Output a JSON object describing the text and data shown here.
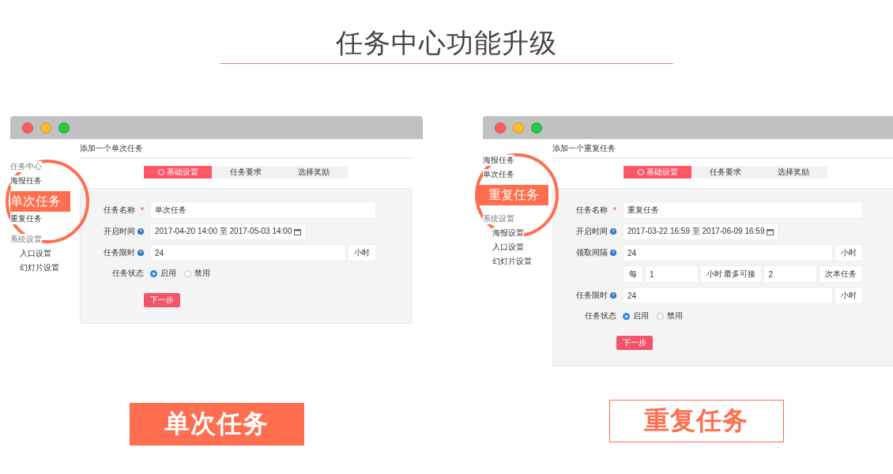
{
  "title": "任务中心功能升级",
  "panels": [
    {
      "window": {
        "sidebar": [
          {
            "kind": "group",
            "label": "任务中心"
          },
          {
            "kind": "item",
            "label": "海报任务"
          },
          {
            "kind": "callout",
            "label": "单次任务"
          },
          {
            "kind": "item",
            "label": "重复任务"
          },
          {
            "kind": "group",
            "label": "系统设置"
          },
          {
            "kind": "subitem",
            "label": "入口设置"
          },
          {
            "kind": "subitem",
            "label": "幻灯片设置"
          }
        ],
        "header": "添加一个单次任务",
        "tabs": [
          {
            "label": "基础设置",
            "selected": true
          },
          {
            "label": "任务要求",
            "selected": false
          },
          {
            "label": "选择奖励",
            "selected": false
          }
        ],
        "form": [
          {
            "kind": "text",
            "label": "任务名称",
            "required_mark": "*",
            "value": "单次任务"
          },
          {
            "kind": "date",
            "label": "开启时间",
            "help": true,
            "value": "2017-04-20 14:00 至 2017-05-03 14:00"
          },
          {
            "kind": "suffix",
            "label": "任务限时",
            "help": true,
            "value": "24",
            "suffix": "小时"
          },
          {
            "kind": "radio",
            "label": "任务状态",
            "options": [
              {
                "label": "启用",
                "selected": true
              },
              {
                "label": "禁用",
                "selected": false
              }
            ]
          }
        ],
        "submit": "下一步"
      },
      "caption": {
        "text": "单次任务",
        "kind": "filled"
      }
    },
    {
      "window": {
        "sidebar": [
          {
            "kind": "item",
            "label": "海报任务"
          },
          {
            "kind": "item",
            "label": "单次任务"
          },
          {
            "kind": "callout",
            "label": "重复任务"
          },
          {
            "kind": "group",
            "label": "系统设置"
          },
          {
            "kind": "subitem",
            "label": "海报设置"
          },
          {
            "kind": "subitem",
            "label": "入口设置"
          },
          {
            "kind": "subitem",
            "label": "幻灯片设置"
          }
        ],
        "header": "添加一个重复任务",
        "tabs": [
          {
            "label": "基础设置",
            "selected": true
          },
          {
            "label": "任务要求",
            "selected": false
          },
          {
            "label": "选择奖励",
            "selected": false
          }
        ],
        "form": [
          {
            "kind": "text",
            "label": "任务名称",
            "required_mark": "*",
            "value": "重复任务"
          },
          {
            "kind": "date",
            "label": "开启时间",
            "help": true,
            "value": "2017-03-22 16:59 至 2017-06-09 16:59"
          },
          {
            "kind": "suffix",
            "label": "领取间隔",
            "help": true,
            "value": "24",
            "suffix": "小时"
          },
          {
            "kind": "interval",
            "parts": [
              {
                "kind": "addon",
                "text": "每"
              },
              {
                "kind": "input",
                "text": "1"
              },
              {
                "kind": "addon",
                "text": "小时 最多可接"
              },
              {
                "kind": "input",
                "text": "2"
              },
              {
                "kind": "addon",
                "text": "次本任务"
              }
            ]
          },
          {
            "kind": "suffix",
            "label": "任务限时",
            "help": true,
            "value": "24",
            "suffix": "小时"
          },
          {
            "kind": "radio",
            "label": "任务状态",
            "options": [
              {
                "label": "启用",
                "selected": true
              },
              {
                "label": "禁用",
                "selected": false
              }
            ]
          }
        ],
        "submit": "下一步"
      },
      "caption": {
        "text": "重复任务",
        "kind": "outline"
      }
    }
  ]
}
